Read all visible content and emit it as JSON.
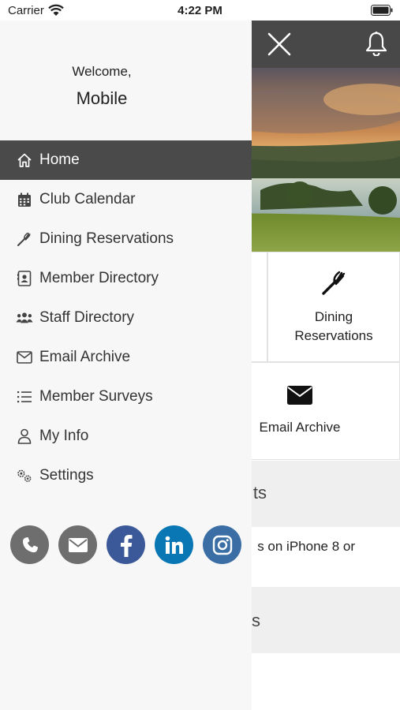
{
  "status_bar": {
    "carrier": "Carrier",
    "time": "4:22 PM"
  },
  "drawer": {
    "welcome": "Welcome,",
    "username": "Mobile",
    "menu": [
      {
        "label": "Home",
        "icon": "home-icon",
        "active": true
      },
      {
        "label": "Club Calendar",
        "icon": "calendar-icon"
      },
      {
        "label": "Dining Reservations",
        "icon": "fork-icon"
      },
      {
        "label": "Member Directory",
        "icon": "contact-card-icon"
      },
      {
        "label": "Staff Directory",
        "icon": "people-icon"
      },
      {
        "label": "Email Archive",
        "icon": "envelope-icon"
      },
      {
        "label": "Member Surveys",
        "icon": "list-icon"
      },
      {
        "label": "My Info",
        "icon": "person-icon"
      },
      {
        "label": "Settings",
        "icon": "gears-icon"
      }
    ],
    "socials": [
      "phone-icon",
      "mail-icon",
      "facebook-icon",
      "linkedin-icon",
      "instagram-icon"
    ]
  },
  "main": {
    "tiles": [
      {
        "label": "Dining\nReservations",
        "icon": "fork-icon"
      },
      {
        "label": "Email Archive",
        "icon": "envelope-icon"
      }
    ],
    "section_1_fragment": "ts",
    "notice_fragment": "s on iPhone 8 or",
    "section_2_fragment": "s"
  },
  "colors": {
    "header": "#484848",
    "drawer_bg": "#f7f7f7",
    "active_item": "#4a4a4a",
    "facebook": "#3b5998",
    "linkedin": "#0a77b5",
    "instagram": "#3a6ea5",
    "gray_social": "#6e6e6e"
  }
}
